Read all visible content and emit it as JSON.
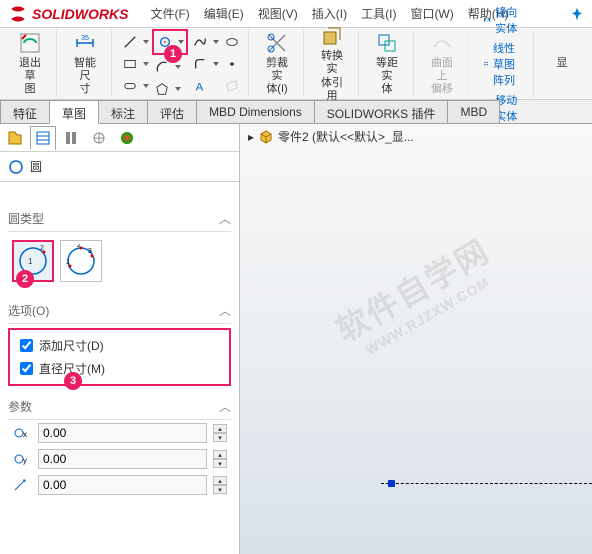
{
  "app": {
    "name": "SOLIDWORKS"
  },
  "menu": {
    "file": "文件(F)",
    "edit": "编辑(E)",
    "view": "视图(V)",
    "insert": "插入(I)",
    "tools": "工具(I)",
    "window": "窗口(W)",
    "help": "帮助(H)"
  },
  "ribbon": {
    "exit_sketch": "退出草\n图",
    "smart_dim": "智能尺\n寸",
    "trim": "剪裁实\n体(I)",
    "convert": "转换实\n体引用",
    "offset": "等距实\n体",
    "surf_offset": "曲面上\n偏移",
    "mirror": "镜向实体",
    "linear_pattern": "线性草图阵列",
    "move": "移动实体",
    "show": "显"
  },
  "tabs": {
    "feature": "特征",
    "sketch": "草图",
    "annotate": "标注",
    "evaluate": "评估",
    "mbd": "MBD Dimensions",
    "plugins": "SOLIDWORKS 插件",
    "mbd2": "MBD"
  },
  "breadcrumb": {
    "part": "零件2 (默认<<默认>_显..."
  },
  "prop": {
    "title": "圆",
    "section_type": "圆类型",
    "section_options": "选项(O)",
    "opt_add_dim": "添加尺寸(D)",
    "opt_diameter_dim": "直径尺寸(M)",
    "section_params": "参数",
    "x_val": "0.00",
    "y_val": "0.00",
    "r_val": "0.00"
  },
  "watermark": {
    "main": "软件自学网",
    "sub": "WWW.RJZXW.COM"
  },
  "badges": {
    "b1": "1",
    "b2": "2",
    "b3": "3"
  },
  "arrow": "▸"
}
